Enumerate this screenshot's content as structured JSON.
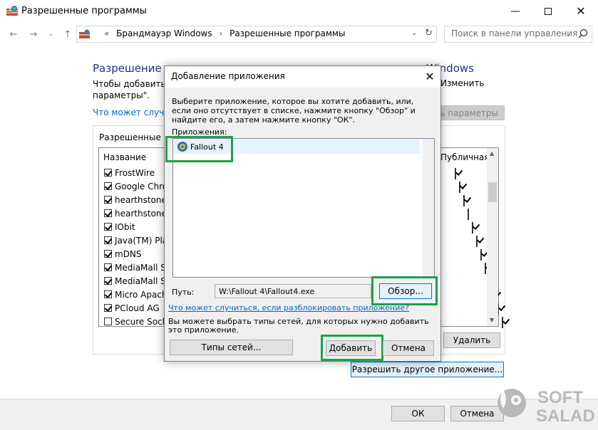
{
  "window": {
    "title": "Разрешенные программы",
    "minimize_icon": "minimize-icon",
    "maximize_icon": "maximize-icon",
    "close_icon": "close-icon"
  },
  "nav": {
    "breadcrumb_prefix": "«",
    "breadcrumb": [
      "Брандмауэр Windows",
      "Разрешенные программы"
    ],
    "search_placeholder": "Поиск в панели управления"
  },
  "main": {
    "heading_left": "Разрешение о",
    "heading_right": "Windows",
    "description_line1": "Чтобы добавить, и",
    "description_line2": "параметры\".",
    "description_right": "Изменить",
    "help_link": "Что может случит",
    "change_settings_button": "ть параметры",
    "group_label": "Разрешенные пр",
    "column_name": "Название",
    "column_public": "Публичная",
    "rows": [
      {
        "name": "FrostWire",
        "checked": true,
        "public": true
      },
      {
        "name": "Google Chron",
        "checked": true,
        "public": true
      },
      {
        "name": "hearthstone",
        "checked": true,
        "public": true
      },
      {
        "name": "hearthstone",
        "checked": true,
        "public": false
      },
      {
        "name": "IObit",
        "checked": true,
        "public": true
      },
      {
        "name": "Java(TM) Plat",
        "checked": true,
        "public": true
      },
      {
        "name": "mDNS",
        "checked": true,
        "public": true
      },
      {
        "name": "MediaMall Se",
        "checked": true,
        "public": true
      },
      {
        "name": "MediaMall Se",
        "checked": true,
        "public": true
      },
      {
        "name": "Micro Apach",
        "checked": true,
        "public": true
      },
      {
        "name": "PCloud AG",
        "checked": true,
        "public": true
      },
      {
        "name": "Secure Socke",
        "checked": false,
        "public": true
      }
    ],
    "remove_button": "Удалить",
    "allow_other_button": "Разрешить другое приложение...",
    "ok_button": "ОК",
    "cancel_button": "Отмена"
  },
  "dialog": {
    "title": "Добавление приложения",
    "description": "Выберите приложение, которое вы хотите добавить, или, если оно отсутствует в списке, нажмите кнопку \"Обзор\" и найдите его, а затем нажмите кнопку \"ОК\".",
    "apps_label": "Приложения:",
    "apps": [
      "Fallout 4"
    ],
    "path_label": "Путь:",
    "path_value": "W:\\Fallout 4\\Fallout4.exe",
    "browse_button": "Обзор...",
    "unblock_link": "Что может случиться, если разблокировать приложение?",
    "network_note": "Вы можете выбрать типы сетей, для которых нужно добавить это приложение.",
    "network_types_button": "Типы сетей...",
    "add_button": "Добавить",
    "cancel_button": "Отмена"
  },
  "watermark": {
    "line1": "SOFT",
    "line2": "SALAD"
  },
  "colors": {
    "highlight": "#1aa34a",
    "heading": "#1e3287",
    "link": "#0066cc"
  }
}
